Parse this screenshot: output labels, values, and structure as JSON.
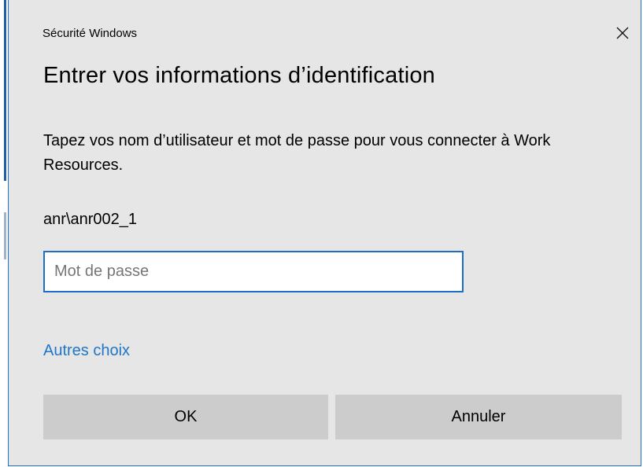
{
  "dialog": {
    "window_title": "Sécurité Windows",
    "heading": "Entrer vos informations d’identification",
    "description": "Tapez vos nom d’utilisateur et mot de passe pour vous connecter à Work Resources.",
    "username": "anr\\anr002_1",
    "password": {
      "value": "",
      "placeholder": "Mot de passe"
    },
    "more_choices_label": "Autres choix",
    "ok_label": "OK",
    "cancel_label": "Annuler",
    "close_icon": "close-icon"
  },
  "colors": {
    "dialog_background": "#e6e6e6",
    "dialog_border": "#1f6fd0",
    "input_border": "#1c6ec6",
    "link": "#1f76c8",
    "button_background": "#cccccc"
  }
}
